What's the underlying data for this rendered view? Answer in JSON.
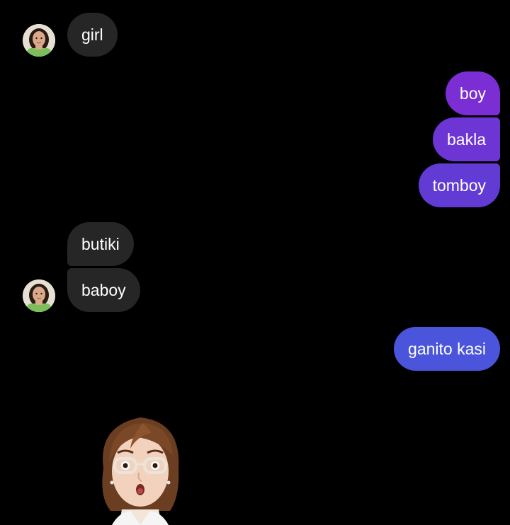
{
  "chat": {
    "messages": [
      {
        "sender": "other",
        "text": "girl"
      },
      {
        "sender": "me",
        "text": "boy"
      },
      {
        "sender": "me",
        "text": "bakla"
      },
      {
        "sender": "me",
        "text": "tomboy"
      },
      {
        "sender": "other",
        "text": "butiki"
      },
      {
        "sender": "other",
        "text": "baboy"
      },
      {
        "sender": "me",
        "text": "ganito kasi"
      }
    ],
    "sticker": {
      "icon": "memoji-woman-surprised-glasses-icon"
    }
  },
  "colors": {
    "background": "#000000",
    "incoming_bubble": "#262626",
    "outgoing_gradient_top": "#8a2fd6",
    "outgoing_gradient_bottom": "#4a55dc",
    "text": "#ffffff"
  }
}
